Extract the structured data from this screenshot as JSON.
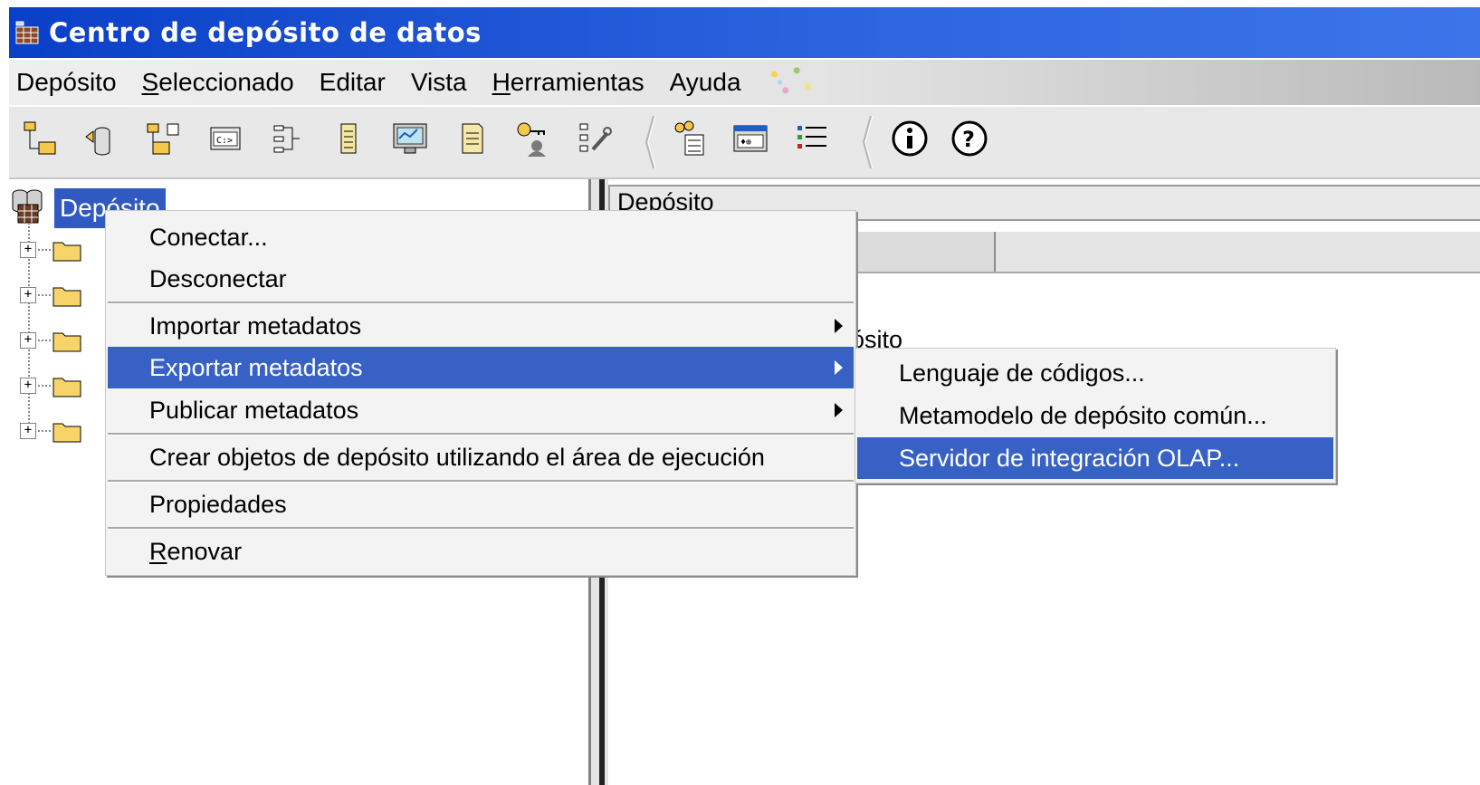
{
  "window": {
    "title": "Centro de depósito de datos",
    "icon": "database-icon"
  },
  "menubar": {
    "items": [
      {
        "label": "Depósito",
        "mnemonic_prefix": "",
        "mnemonic": "",
        "rest": "Depósito"
      },
      {
        "label": "Seleccionado",
        "mnemonic": "S",
        "rest": "eleccionado"
      },
      {
        "label": "Editar",
        "mnemonic": "",
        "rest": "Editar"
      },
      {
        "label": "Vista",
        "mnemonic": "",
        "rest": "Vista"
      },
      {
        "label": "Herramientas",
        "mnemonic": "H",
        "rest": "erramientas"
      },
      {
        "label": "Ayuda",
        "mnemonic": "",
        "rest": "Ayuda"
      }
    ]
  },
  "toolbar": {
    "icons": [
      "subject-areas-icon",
      "sources-icon",
      "targets-icon",
      "agent-sites-icon",
      "programs-icon",
      "document-icon",
      "monitor-icon",
      "notes-icon",
      "security-keys-icon",
      "tools-icon",
      "users-groups-icon",
      "work-in-progress-icon",
      "list-icon",
      "info-icon",
      "help-icon"
    ],
    "colors": {
      "accent": "#2b5fd9",
      "yellow": "#f4c84a"
    }
  },
  "tree": {
    "root_label": "Depósito",
    "children_count": 5
  },
  "right_pane": {
    "header": "Depósito",
    "visible_fragment": "ósito"
  },
  "context_menu": {
    "items": [
      {
        "label": "Conectar...",
        "submenu": false,
        "highlighted": false
      },
      {
        "label": "Desconectar",
        "submenu": false,
        "highlighted": false
      },
      {
        "label": "Importar metadatos",
        "submenu": true,
        "highlighted": false
      },
      {
        "label": "Exportar metadatos",
        "submenu": true,
        "highlighted": true
      },
      {
        "label": "Publicar metadatos",
        "submenu": true,
        "highlighted": false
      },
      {
        "label": "Crear objetos de depósito utilizando el área de ejecución",
        "submenu": false,
        "highlighted": false
      },
      {
        "label": "Propiedades",
        "submenu": false,
        "highlighted": false
      },
      {
        "label_mnemonic": "R",
        "label_rest": "enovar",
        "label": "Renovar",
        "submenu": false,
        "highlighted": false
      }
    ]
  },
  "submenu": {
    "items": [
      {
        "label": "Lenguaje de códigos...",
        "highlighted": false
      },
      {
        "label": "Metamodelo de depósito común...",
        "highlighted": false
      },
      {
        "label": "Servidor de integración OLAP...",
        "highlighted": true
      }
    ]
  },
  "colors": {
    "title_bar": "#0a3fc7",
    "selection": "#3861c5",
    "menu_bg": "#f3f3f3"
  }
}
